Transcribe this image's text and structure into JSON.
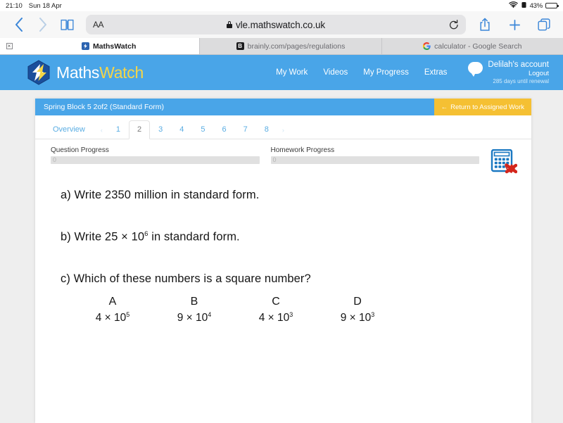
{
  "status_bar": {
    "time": "21:10",
    "date": "Sun 18 Apr",
    "battery_percent": "43%",
    "wifi_icon": "wifi-icon",
    "alarm_icon": "alarm-icon",
    "battery_icon": "battery-icon"
  },
  "browser": {
    "back_icon": "chevron-left-icon",
    "forward_icon": "chevron-right-icon",
    "bookmarks_icon": "book-icon",
    "text_size_label": "AA",
    "lock_icon": "lock-icon",
    "url": "vle.mathswatch.co.uk",
    "reload_icon": "reload-icon",
    "share_icon": "share-icon",
    "new_tab_icon": "plus-icon",
    "tab_overview_icon": "tabs-icon",
    "close_tab_label": "×",
    "tabs": [
      {
        "label": "MathsWatch",
        "favicon": "mathswatch-favicon",
        "active": true
      },
      {
        "label": "brainly.com/pages/regulations",
        "favicon": "brainly-favicon",
        "active": false
      },
      {
        "label": "calculator - Google Search",
        "favicon": "google-favicon",
        "active": false
      }
    ]
  },
  "site_header": {
    "logo_text_1": "Maths",
    "logo_text_2": "Watch",
    "logo_icon": "mathswatch-logo-icon",
    "nav": [
      {
        "label": "My Work"
      },
      {
        "label": "Videos"
      },
      {
        "label": "My Progress"
      },
      {
        "label": "Extras"
      }
    ],
    "account_icon": "speech-bubble-icon",
    "account_name": "Delilah's account",
    "logout_label": "Logout",
    "renewal_text": "285 days until renewal"
  },
  "assignment": {
    "title": "Spring Block 5 2of2 (Standard Form)",
    "return_label": "Return to Assigned Work",
    "return_arrow": "←"
  },
  "question_tabs": {
    "overview_label": "Overview",
    "prev_arrow": "‹",
    "next_arrow": "›",
    "numbers": [
      "1",
      "2",
      "3",
      "4",
      "5",
      "6",
      "7",
      "8"
    ],
    "active": "2"
  },
  "progress": {
    "question_label": "Question Progress",
    "question_value": "0",
    "homework_label": "Homework Progress",
    "homework_value": "0",
    "calculator_icon": "calculator-not-allowed-icon"
  },
  "question": {
    "part_a_prefix": "a) Write 2350 million in standard form.",
    "part_b_pre": "b) Write 25 × 10",
    "part_b_exp": "6",
    "part_b_post": " in standard form.",
    "part_c": "c) Which of these numbers is a square number?",
    "options": [
      {
        "letter": "A",
        "coefficient": "4 × 10",
        "exponent": "5"
      },
      {
        "letter": "B",
        "coefficient": "9 × 10",
        "exponent": "4"
      },
      {
        "letter": "C",
        "coefficient": "4 × 10",
        "exponent": "3"
      },
      {
        "letter": "D",
        "coefficient": "9 × 10",
        "exponent": "3"
      }
    ]
  },
  "colors": {
    "brand_blue": "#49a5e8",
    "brand_yellow": "#f5c033",
    "logo_yellow": "#f5d547",
    "safari_blue": "#3b86d8"
  }
}
